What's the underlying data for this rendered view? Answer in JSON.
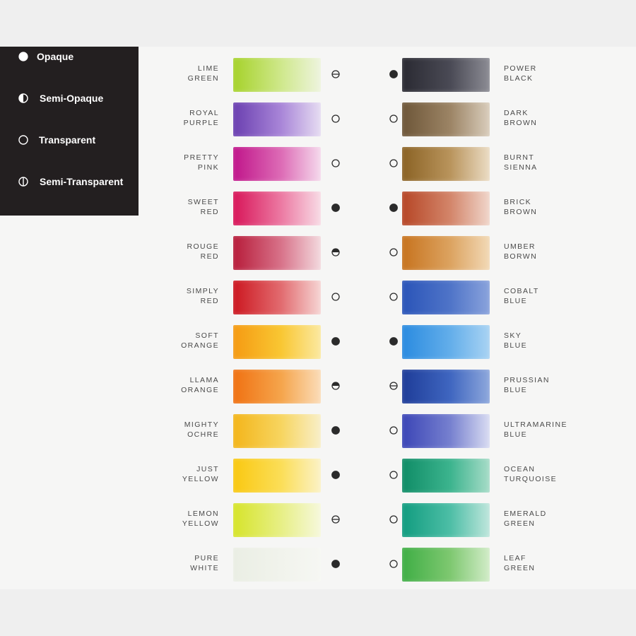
{
  "legend": {
    "items": [
      {
        "label": "Opaque",
        "icon": "opaque-circle-icon"
      },
      {
        "label": "Semi-Opaque",
        "icon": "semi-opaque-circle-icon"
      },
      {
        "label": "Transparent",
        "icon": "transparent-circle-icon"
      },
      {
        "label": "Semi-Transparent",
        "icon": "semi-transparent-circle-icon"
      }
    ]
  },
  "left_colors": [
    {
      "line1": "LIME",
      "line2": "GREEN",
      "opacity": "semi-transparent",
      "c1": "#a6d22a",
      "c2": "#cfe88c",
      "c3": "#eef4de"
    },
    {
      "line1": "ROYAL",
      "line2": "PURPLE",
      "opacity": "transparent",
      "c1": "#6a3fb0",
      "c2": "#a986d8",
      "c3": "#e6dcf2"
    },
    {
      "line1": "PRETTY",
      "line2": "PINK",
      "opacity": "transparent",
      "c1": "#c0158a",
      "c2": "#dd6cb6",
      "c3": "#f5d9ec"
    },
    {
      "line1": "SWEET",
      "line2": "RED",
      "opacity": "opaque",
      "c1": "#d81659",
      "c2": "#ec7aa3",
      "c3": "#f8dbe5"
    },
    {
      "line1": "ROUGE",
      "line2": "RED",
      "opacity": "semi-opaque",
      "c1": "#b71c3a",
      "c2": "#d8738a",
      "c3": "#f3d9de"
    },
    {
      "line1": "SIMPLY",
      "line2": "RED",
      "opacity": "transparent",
      "c1": "#cc1720",
      "c2": "#e26c70",
      "c3": "#f6d5d4"
    },
    {
      "line1": "SOFT",
      "line2": "ORANGE",
      "opacity": "opaque",
      "c1": "#f59a12",
      "c2": "#f9c733",
      "c3": "#fbe9a0"
    },
    {
      "line1": "LLAMA",
      "line2": "ORANGE",
      "opacity": "semi-opaque",
      "c1": "#f07112",
      "c2": "#f5a54c",
      "c3": "#fbdcb8"
    },
    {
      "line1": "MIGHTY",
      "line2": "OCHRE",
      "opacity": "opaque",
      "c1": "#f3b51a",
      "c2": "#f7d560",
      "c3": "#f8efc8"
    },
    {
      "line1": "JUST",
      "line2": "YELLOW",
      "opacity": "opaque",
      "c1": "#f9c811",
      "c2": "#fbde58",
      "c3": "#fbf2c6"
    },
    {
      "line1": "LEMON",
      "line2": "YELLOW",
      "opacity": "semi-transparent",
      "c1": "#d6e42a",
      "c2": "#e7ef86",
      "c3": "#f6f8dc"
    },
    {
      "line1": "PURE",
      "line2": "WHITE",
      "opacity": "opaque",
      "c1": "#eaeee4",
      "c2": "#f1f3ec",
      "c3": "#f6f7f3"
    }
  ],
  "right_colors": [
    {
      "line1": "POWER",
      "line2": "BLACK",
      "opacity": "opaque",
      "c1": "#2a2a32",
      "c2": "#4a4a55",
      "c3": "#8c8c94"
    },
    {
      "line1": "DARK",
      "line2": "BROWN",
      "opacity": "transparent",
      "c1": "#6d5638",
      "c2": "#9c8465",
      "c3": "#d9cdbc"
    },
    {
      "line1": "BURNT",
      "line2": "SIENNA",
      "opacity": "transparent",
      "c1": "#8a6224",
      "c2": "#b9945c",
      "c3": "#ebdcc4"
    },
    {
      "line1": "BRICK",
      "line2": "BROWN",
      "opacity": "opaque",
      "c1": "#b64626",
      "c2": "#d3856a",
      "c3": "#f0d6cb"
    },
    {
      "line1": "UMBER",
      "line2": "BORWN",
      "opacity": "transparent",
      "c1": "#c7731e",
      "c2": "#dca360",
      "c3": "#f2d9b6"
    },
    {
      "line1": "COBALT",
      "line2": "BLUE",
      "opacity": "transparent",
      "c1": "#2a54b8",
      "c2": "#4f74c8",
      "c3": "#8aa3dc"
    },
    {
      "line1": "SKY",
      "line2": "BLUE",
      "opacity": "opaque",
      "c1": "#2a8be0",
      "c2": "#63aeea",
      "c3": "#a9d3f3"
    },
    {
      "line1": "PRUSSIAN",
      "line2": "BLUE",
      "opacity": "semi-transparent",
      "c1": "#1e3c98",
      "c2": "#3f66c0",
      "c3": "#8ea8dc"
    },
    {
      "line1": "ULTRAMARINE",
      "line2": "BLUE",
      "opacity": "transparent",
      "c1": "#3b45b6",
      "c2": "#7680cf",
      "c3": "#d9dcf2"
    },
    {
      "line1": "OCEAN",
      "line2": "TURQUOISE",
      "opacity": "transparent",
      "c1": "#0f8c66",
      "c2": "#3cb48e",
      "c3": "#a7dcc8"
    },
    {
      "line1": "EMERALD",
      "line2": "GREEN",
      "opacity": "transparent",
      "c1": "#119c7f",
      "c2": "#4dbea6",
      "c3": "#bfe6dc"
    },
    {
      "line1": "LEAF",
      "line2": "GREEN",
      "opacity": "transparent",
      "c1": "#3fae45",
      "c2": "#7ec870",
      "c3": "#d2ecc8"
    }
  ]
}
